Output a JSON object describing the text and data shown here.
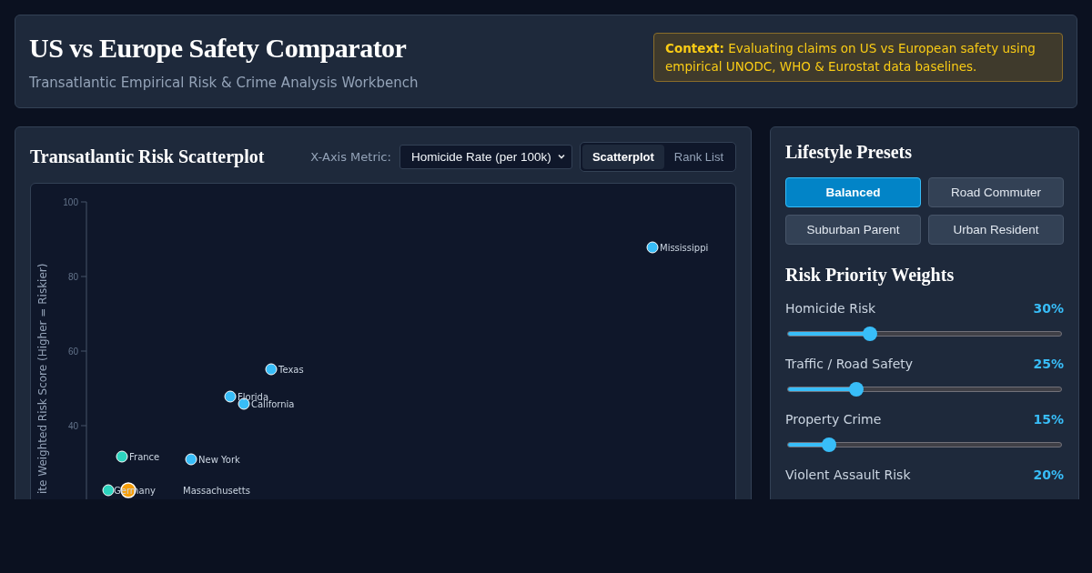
{
  "header": {
    "title": "US vs Europe Safety Comparator",
    "subtitle": "Transatlantic Empirical Risk & Crime Analysis Workbench",
    "context": "**Context:** Evaluating claims on US vs European safety using empirical UNODC, WHO & Eurostat data baselines."
  },
  "scatter_panel": {
    "title": "Transatlantic Risk Scatterplot",
    "metric_label": "X-Axis Metric:",
    "metric_value": "Homicide Rate (per 100k)",
    "views": [
      {
        "label": "Scatterplot",
        "selected": true
      },
      {
        "label": "Rank List",
        "selected": false
      }
    ],
    "plot": {
      "axis_title": "ite Weighted Risk Score (Higher = Riskier)",
      "ticks": [
        "100",
        "80",
        "60",
        "40"
      ],
      "points": [
        {
          "label": "Mississippi",
          "color": "#38bdf8"
        },
        {
          "label": "Texas",
          "color": "#38bdf8"
        },
        {
          "label": "Florida",
          "color": "#38bdf8"
        },
        {
          "label": "California",
          "color": "#38bdf8"
        },
        {
          "label": "France",
          "color": "#2dd4bf"
        },
        {
          "label": "New York",
          "color": "#38bdf8"
        },
        {
          "label": "Germany",
          "color": "#2dd4bf"
        },
        {
          "label": "Massachusetts",
          "color": "#f59e0b",
          "selected": true
        }
      ]
    }
  },
  "presets": {
    "title": "Lifestyle Presets",
    "items": [
      {
        "label": "Balanced",
        "selected": true
      },
      {
        "label": "Road Commuter",
        "selected": false
      },
      {
        "label": "Suburban Parent",
        "selected": false
      },
      {
        "label": "Urban Resident",
        "selected": false
      }
    ]
  },
  "weights": {
    "title": "Risk Priority Weights",
    "items": [
      {
        "label": "Homicide Risk",
        "value": "30%",
        "level": 0.3
      },
      {
        "label": "Traffic / Road Safety",
        "value": "25%",
        "level": 0.25
      },
      {
        "label": "Property Crime",
        "value": "15%",
        "level": 0.15
      },
      {
        "label": "Violent Assault Risk",
        "value": "20%"
      }
    ]
  }
}
